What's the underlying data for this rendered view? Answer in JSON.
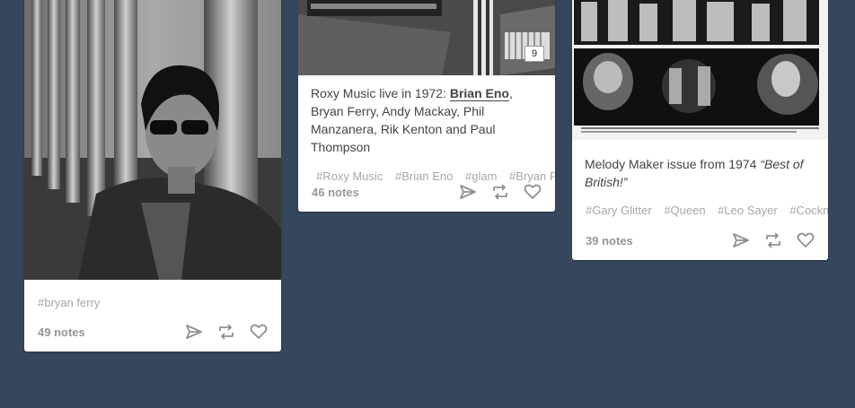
{
  "posts": [
    {
      "tags": [
        "#bryan ferry"
      ],
      "notes": "49 notes",
      "actions": [
        "share-icon",
        "reblog-icon",
        "like-icon"
      ]
    },
    {
      "photo_counter": "9",
      "caption": {
        "prefix": "Roxy Music live in 1972: ",
        "bold": "Brian Eno",
        "suffix": ", Bryan Ferry, Andy Mackay, Phil Manzanera, Rik Kenton and Paul Thompson"
      },
      "tags": [
        "#Roxy Music",
        "#Brian Eno",
        "#glam",
        "#Bryan Ferry"
      ],
      "notes": "46 notes",
      "actions": [
        "share-icon",
        "reblog-icon",
        "like-icon"
      ]
    },
    {
      "caption": {
        "prefix": "Melody Maker issue from 1974 ",
        "italic": "“Best of British!”"
      },
      "tags": [
        "#Gary Glitter",
        "#Queen",
        "#Leo Sayer",
        "#Cockney Rebel"
      ],
      "notes": "39 notes",
      "actions": [
        "share-icon",
        "reblog-icon",
        "like-icon"
      ]
    }
  ]
}
